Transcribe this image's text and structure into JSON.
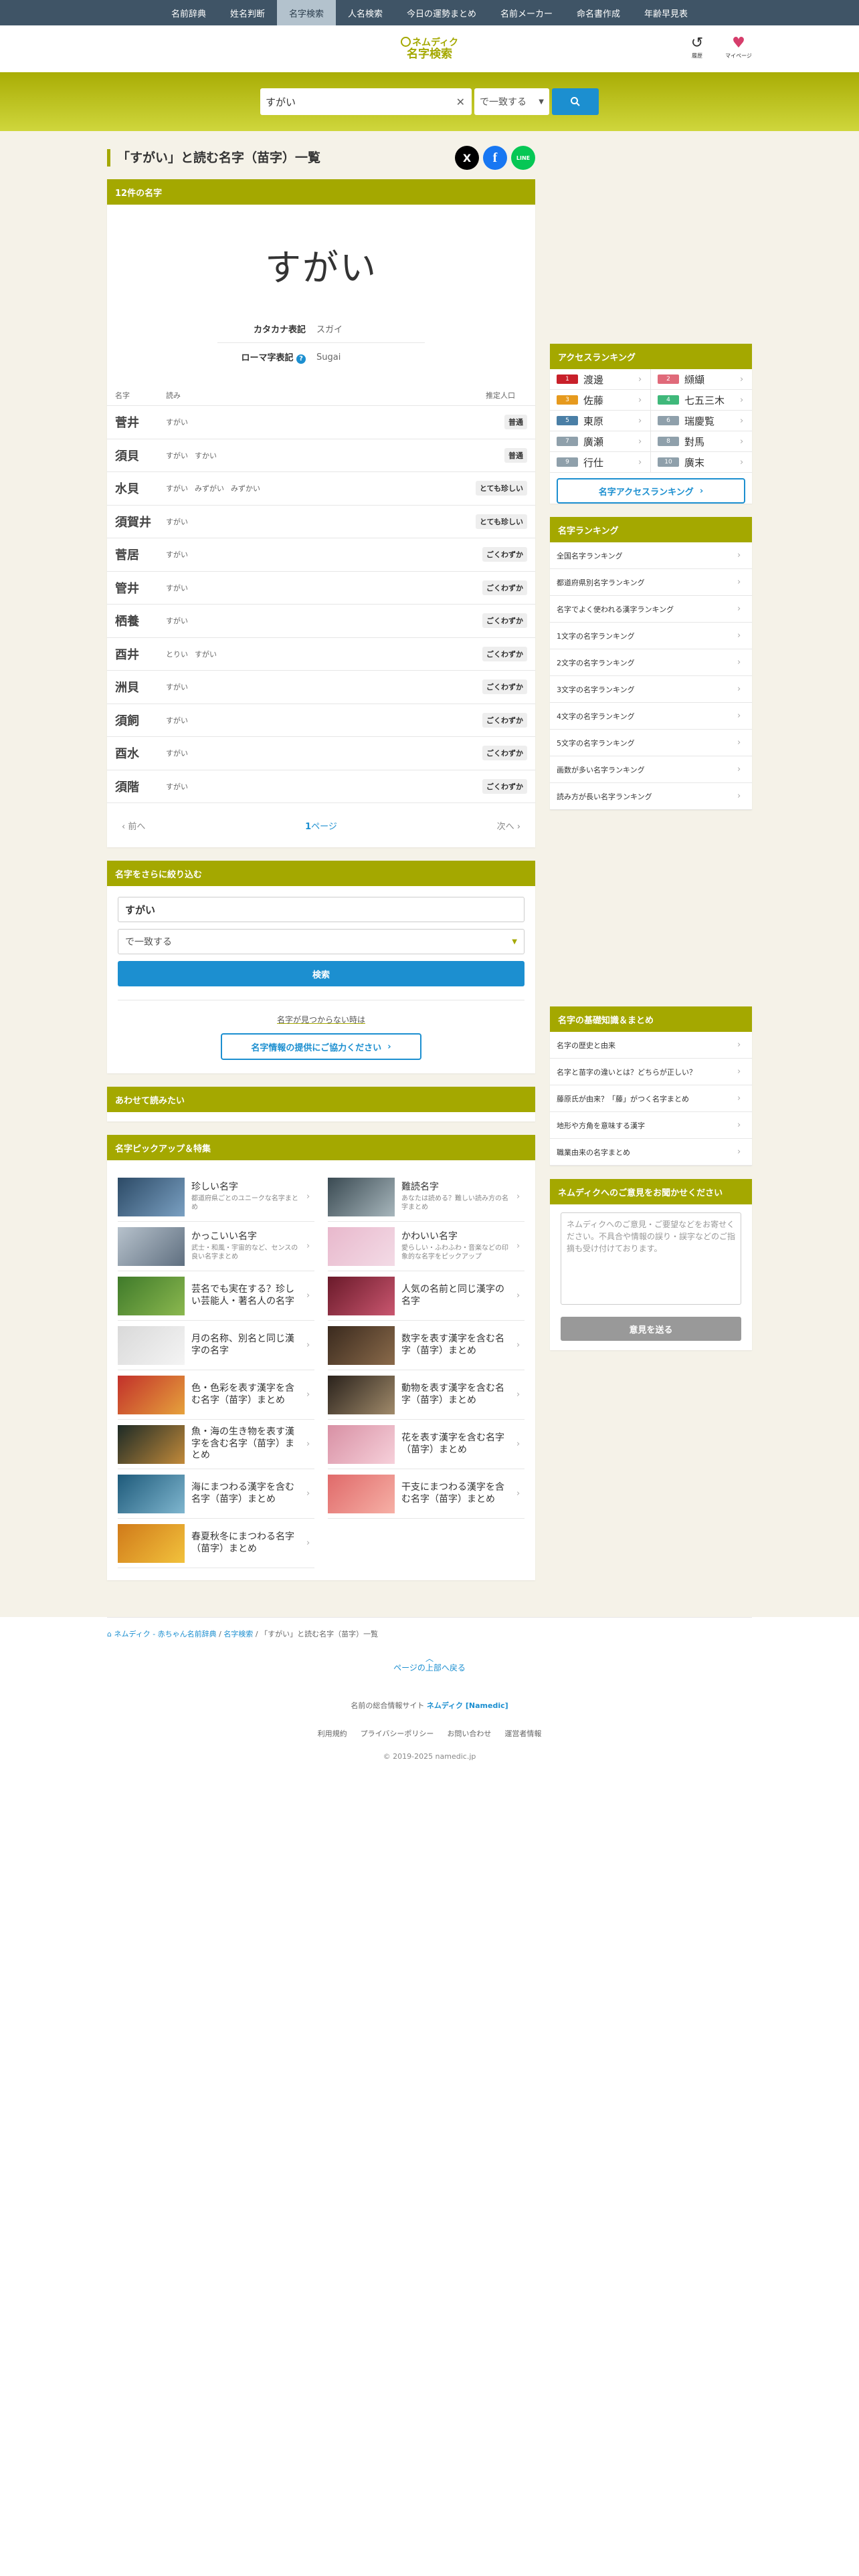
{
  "nav": {
    "items": [
      "名前辞典",
      "姓名判断",
      "名字検索",
      "人名検索",
      "今日の運勢まとめ",
      "名前メーカー",
      "命名書作成",
      "年齢早見表"
    ],
    "active": 2
  },
  "header": {
    "logo_top": "ネムディク",
    "logo_bottom": "名字検索",
    "history_label": "履歴",
    "mypage_label": "マイページ"
  },
  "search": {
    "value": "すがい",
    "select": "で一致する"
  },
  "page": {
    "title": "「すがい」と読む名字（苗字）一覧"
  },
  "share": [
    "X",
    "f",
    "LINE"
  ],
  "result": {
    "header": "12件の名字",
    "big_reading": "すがい",
    "katakana_label": "カタカナ表記",
    "katakana": "スガイ",
    "roman_label": "ローマ字表記",
    "roman": "Sugai",
    "col_name": "名字",
    "col_reading": "読み",
    "col_pop": "推定人口",
    "rows": [
      {
        "name": "菅井",
        "readings": [
          "すがい"
        ],
        "pop": "普通"
      },
      {
        "name": "須貝",
        "readings": [
          "すがい",
          "すかい"
        ],
        "pop": "普通"
      },
      {
        "name": "水貝",
        "readings": [
          "すがい",
          "みずがい",
          "みずかい"
        ],
        "pop": "とても珍しい"
      },
      {
        "name": "須賀井",
        "readings": [
          "すがい"
        ],
        "pop": "とても珍しい"
      },
      {
        "name": "菅居",
        "readings": [
          "すがい"
        ],
        "pop": "ごくわずか"
      },
      {
        "name": "管井",
        "readings": [
          "すがい"
        ],
        "pop": "ごくわずか"
      },
      {
        "name": "栖養",
        "readings": [
          "すがい"
        ],
        "pop": "ごくわずか"
      },
      {
        "name": "酉井",
        "readings": [
          "とりい",
          "すがい"
        ],
        "pop": "ごくわずか"
      },
      {
        "name": "洲貝",
        "readings": [
          "すがい"
        ],
        "pop": "ごくわずか"
      },
      {
        "name": "須飼",
        "readings": [
          "すがい"
        ],
        "pop": "ごくわずか"
      },
      {
        "name": "酉水",
        "readings": [
          "すがい"
        ],
        "pop": "ごくわずか"
      },
      {
        "name": "須階",
        "readings": [
          "すがい"
        ],
        "pop": "ごくわずか"
      }
    ],
    "prev": "前へ",
    "page_num": "1",
    "page_suffix": "ページ",
    "next": "次へ"
  },
  "refine": {
    "header": "名字をさらに絞り込む",
    "value": "すがい",
    "select": "で一致する",
    "button": "検索",
    "note": "名字が見つからない時は",
    "coop": "名字情報の提供にご協力ください"
  },
  "also": {
    "header": "あわせて読みたい"
  },
  "picks": {
    "header": "名字ピックアップ＆特集",
    "items": [
      {
        "title": "珍しい名字",
        "sub": "都道府県ごとのユニークな名字まとめ",
        "colors": [
          "#2c4a66",
          "#7aa0c2"
        ]
      },
      {
        "title": "難読名字",
        "sub": "あなたは読める？難しい読み方の名字まとめ",
        "colors": [
          "#3a4a52",
          "#a7b6bc"
        ]
      },
      {
        "title": "かっこいい名字",
        "sub": "武士・和風・宇宙的など、センスの良い名字まとめ",
        "colors": [
          "#b7c2cc",
          "#5f6f80"
        ]
      },
      {
        "title": "かわいい名字",
        "sub": "愛らしい・ふわふわ・音楽などの印象的な名字をピックアップ",
        "colors": [
          "#e8b8cc",
          "#f3dbe6"
        ]
      },
      {
        "title": "芸名でも実在する？珍しい芸能人・著名人の名字",
        "sub": "",
        "colors": [
          "#3f7a2a",
          "#8bb84f"
        ]
      },
      {
        "title": "人気の名前と同じ漢字の名字",
        "sub": "",
        "colors": [
          "#6a1a2a",
          "#c9566f"
        ]
      },
      {
        "title": "月の名称、別名と同じ漢字の名字",
        "sub": "",
        "colors": [
          "#d9d9d9",
          "#f4f4f4"
        ]
      },
      {
        "title": "数字を表す漢字を含む名字（苗字）まとめ",
        "sub": "",
        "colors": [
          "#3a2a1e",
          "#8a6a4a"
        ]
      },
      {
        "title": "色・色彩を表す漢字を含む名字（苗字）まとめ",
        "sub": "",
        "colors": [
          "#c2302a",
          "#e6a23c"
        ]
      },
      {
        "title": "動物を表す漢字を含む名字（苗字）まとめ",
        "sub": "",
        "colors": [
          "#2a221c",
          "#a08a6a"
        ]
      },
      {
        "title": "魚・海の生き物を表す漢字を含む名字（苗字）まとめ",
        "sub": "",
        "colors": [
          "#1c2a26",
          "#c28a3a"
        ]
      },
      {
        "title": "花を表す漢字を含む名字（苗字）まとめ",
        "sub": "",
        "colors": [
          "#d890a4",
          "#f6d0da"
        ]
      },
      {
        "title": "海にまつわる漢字を含む名字（苗字）まとめ",
        "sub": "",
        "colors": [
          "#1e5a7a",
          "#7fb6cf"
        ]
      },
      {
        "title": "干支にまつわる漢字を含む名字（苗字）まとめ",
        "sub": "",
        "colors": [
          "#e06a6a",
          "#f6b0a6"
        ]
      },
      {
        "title": "春夏秋冬にまつわる名字（苗字）まとめ",
        "sub": "",
        "colors": [
          "#d07a1a",
          "#f2c23c"
        ]
      }
    ]
  },
  "access": {
    "header": "アクセスランキング",
    "items": [
      {
        "rank": "1",
        "name": "渡邊",
        "color": "#c8202a"
      },
      {
        "rank": "2",
        "name": "纐纈",
        "color": "#e06a7a"
      },
      {
        "rank": "3",
        "name": "佐藤",
        "color": "#e69a1e"
      },
      {
        "rank": "4",
        "name": "七五三木",
        "color": "#3fb87a"
      },
      {
        "rank": "5",
        "name": "東原",
        "color": "#4a7fa6"
      },
      {
        "rank": "6",
        "name": "瑞慶覧",
        "color": "#8fa0ab"
      },
      {
        "rank": "7",
        "name": "廣瀬",
        "color": "#8fa0ab"
      },
      {
        "rank": "8",
        "name": "對馬",
        "color": "#8fa0ab"
      },
      {
        "rank": "9",
        "name": "行仕",
        "color": "#8fa0ab"
      },
      {
        "rank": "10",
        "name": "廣末",
        "color": "#8fa0ab"
      }
    ],
    "button": "名字アクセスランキング"
  },
  "ranking": {
    "header": "名字ランキング",
    "items": [
      "全国名字ランキング",
      "都道府県別名字ランキング",
      "名字でよく使われる漢字ランキング",
      "1文字の名字ランキング",
      "2文字の名字ランキング",
      "3文字の名字ランキング",
      "4文字の名字ランキング",
      "5文字の名字ランキング",
      "画数が多い名字ランキング",
      "読み方が長い名字ランキング"
    ]
  },
  "basics": {
    "header": "名字の基礎知識＆まとめ",
    "items": [
      "名字の歴史と由来",
      "名字と苗字の違いとは？どちらが正しい？",
      "藤原氏が由来？「藤」がつく名字まとめ",
      "地形や方角を意味する漢字",
      "職業由来の名字まとめ"
    ]
  },
  "feedback": {
    "header": "ネムディクへのご意見をお聞かせください",
    "placeholder": "ネムディクへのご意見・ご要望などをお寄せください。不具合や情報の誤り・誤字などのご指摘も受け付けております。",
    "button": "意見を送る"
  },
  "breadcrumb": {
    "home": "ネムディク - 赤ちゃん名前辞典",
    "mid": "名字検索",
    "current": "「すがい」と読む名字（苗字）一覧"
  },
  "footer": {
    "backtop": "ページの上部へ戻る",
    "desc_prefix": "名前の総合情報サイト",
    "brand": "ネムディク [Namedic]",
    "links": [
      "利用規約",
      "プライバシーポリシー",
      "お問い合わせ",
      "運営者情報"
    ],
    "copyright": "© 2019-2025 namedic.jp"
  }
}
